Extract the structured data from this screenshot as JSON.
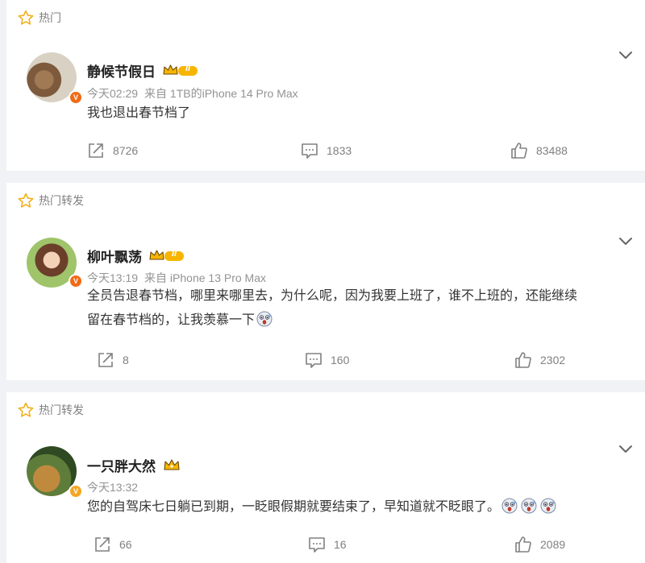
{
  "posts": [
    {
      "tag": "热门",
      "username": "静候节假日",
      "badge": "II",
      "verified": "V",
      "time": "今天02:29",
      "source": "来自 1TB的iPhone 14 Pro Max",
      "content": "我也退出春节档了",
      "reposts": "8726",
      "comments": "1833",
      "likes": "83488"
    },
    {
      "tag": "热门转发",
      "username": "柳叶飘荡",
      "badge": "II",
      "verified": "V",
      "time": "今天13:19",
      "source": "来自 iPhone 13 Pro Max",
      "content_line1": "全员告退春节档，哪里来哪里去，为什么呢，因为我要上班了，谁不上班的，还能继续",
      "content_line2": "留在春节档的，让我羡慕一下",
      "reposts": "8",
      "comments": "160",
      "likes": "2302"
    },
    {
      "tag": "热门转发",
      "username": "一只胖大然",
      "verified": "V",
      "time": "今天13:32",
      "content": "您的自驾床七日躺已到期，一眨眼假期就要结束了，早知道就不眨眼了。",
      "reposts": "66",
      "comments": "16",
      "likes": "2089"
    }
  ],
  "icons": {
    "tag": "star-icon",
    "more": "chevron-down-icon",
    "repost": "repost-icon",
    "comment": "comment-icon",
    "like": "thumbs-up-icon",
    "emoji": "shocked-emoji-icon"
  },
  "colors": {
    "verified_orange": "#f26a14",
    "verified_gold": "#f5a623",
    "tag_star": "#f2b11b",
    "badge_gold": "#f7b500"
  }
}
